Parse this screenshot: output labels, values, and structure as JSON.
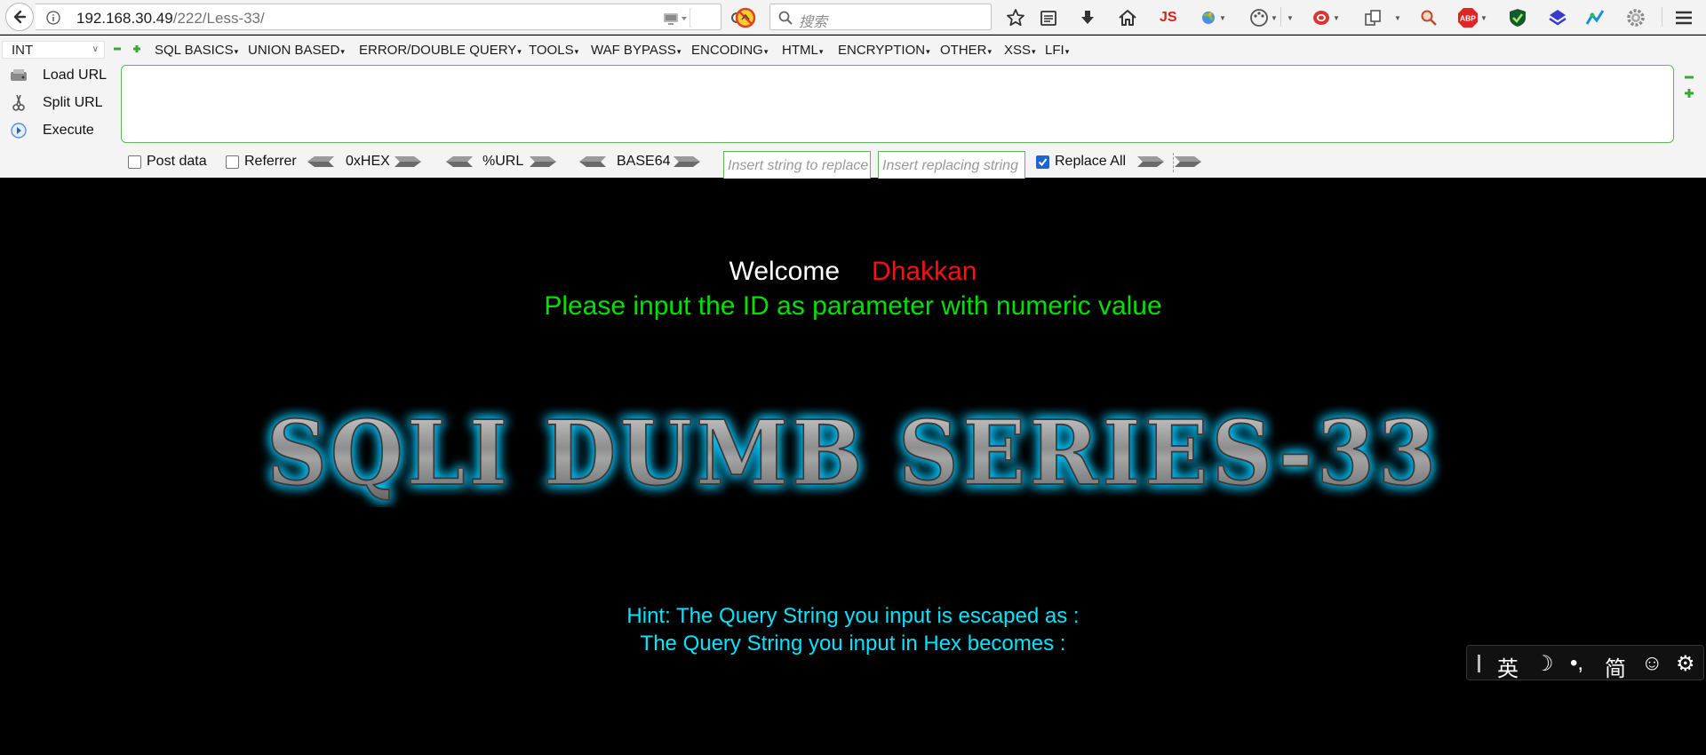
{
  "browser": {
    "url_host": "192.168.30.49",
    "url_path": "/222/Less-33/",
    "search_placeholder": "搜索",
    "js_label": "JS",
    "abp_label": "ABP"
  },
  "hackbar": {
    "method": "INT",
    "menus": [
      "SQL BASICS",
      "UNION BASED",
      "ERROR/DOUBLE QUERY",
      "TOOLS",
      "WAF BYPASS",
      "ENCODING",
      "HTML",
      "ENCRYPTION",
      "OTHER",
      "XSS",
      "LFI"
    ],
    "load_url": "Load URL",
    "split_url": "Split URL",
    "execute": "Execute",
    "url_value": "",
    "post_data": "Post data",
    "referrer": "Referrer",
    "hex": "0xHEX",
    "urlenc": "%URL",
    "base64": "BASE64",
    "replace_placeholder": "Insert string to replace",
    "replacing_placeholder": "Insert replacing string",
    "replace_all": "Replace All",
    "replace_all_checked": true
  },
  "page": {
    "welcome": "Welcome",
    "name": "Dhakkan",
    "prompt": "Please input the ID as parameter with numeric value",
    "banner": "SQLI DUMB SERIES-33",
    "hint1": "Hint: The Query String you input is escaped as :",
    "hint2": "The Query String you input in Hex becomes :"
  },
  "ime": {
    "lang": "英",
    "moon": "☽",
    "punct": "•,",
    "simplified": "简",
    "emoji": "☺",
    "settings": "⚙"
  },
  "colors": {
    "welcome": "#ffffff",
    "name": "#ff1010",
    "prompt": "#00e000",
    "hint": "#00e5ff",
    "banner_glow": "#00c8ff"
  }
}
